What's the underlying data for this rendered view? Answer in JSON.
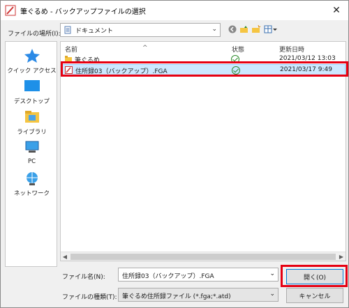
{
  "window": {
    "title": "筆ぐるめ - バックアップファイルの選択",
    "close_glyph": "✕"
  },
  "location": {
    "label": "ファイルの場所(I):",
    "value": "ドキュメント"
  },
  "sidebar": {
    "items": [
      {
        "label": "クイック アクセス",
        "icon": "star-icon"
      },
      {
        "label": "デスクトップ",
        "icon": "desktop-icon"
      },
      {
        "label": "ライブラリ",
        "icon": "library-icon"
      },
      {
        "label": "PC",
        "icon": "pc-icon"
      },
      {
        "label": "ネットワーク",
        "icon": "network-icon"
      }
    ]
  },
  "filelist": {
    "headers": {
      "name": "名前",
      "status": "状態",
      "date": "更新日時"
    },
    "sort_caret": "^",
    "rows": [
      {
        "name": "筆ぐるめ",
        "date": "2021/03/12 13:03"
      },
      {
        "name": "住所録03（バックアップ）.FGA",
        "date": "2021/03/17 9:49"
      }
    ]
  },
  "filename": {
    "label": "ファイル名(N):",
    "value": "住所録03（バックアップ）.FGA"
  },
  "filetype": {
    "label": "ファイルの種類(T):",
    "value": "筆ぐるめ住所録ファイル (*.fga;*.atd)"
  },
  "buttons": {
    "open": "開く(O)",
    "cancel": "キャンセル"
  },
  "colors": {
    "highlight": "#e60012",
    "selection": "#cce8ff",
    "folder": "#f5c542",
    "accent": "#0078d7"
  }
}
